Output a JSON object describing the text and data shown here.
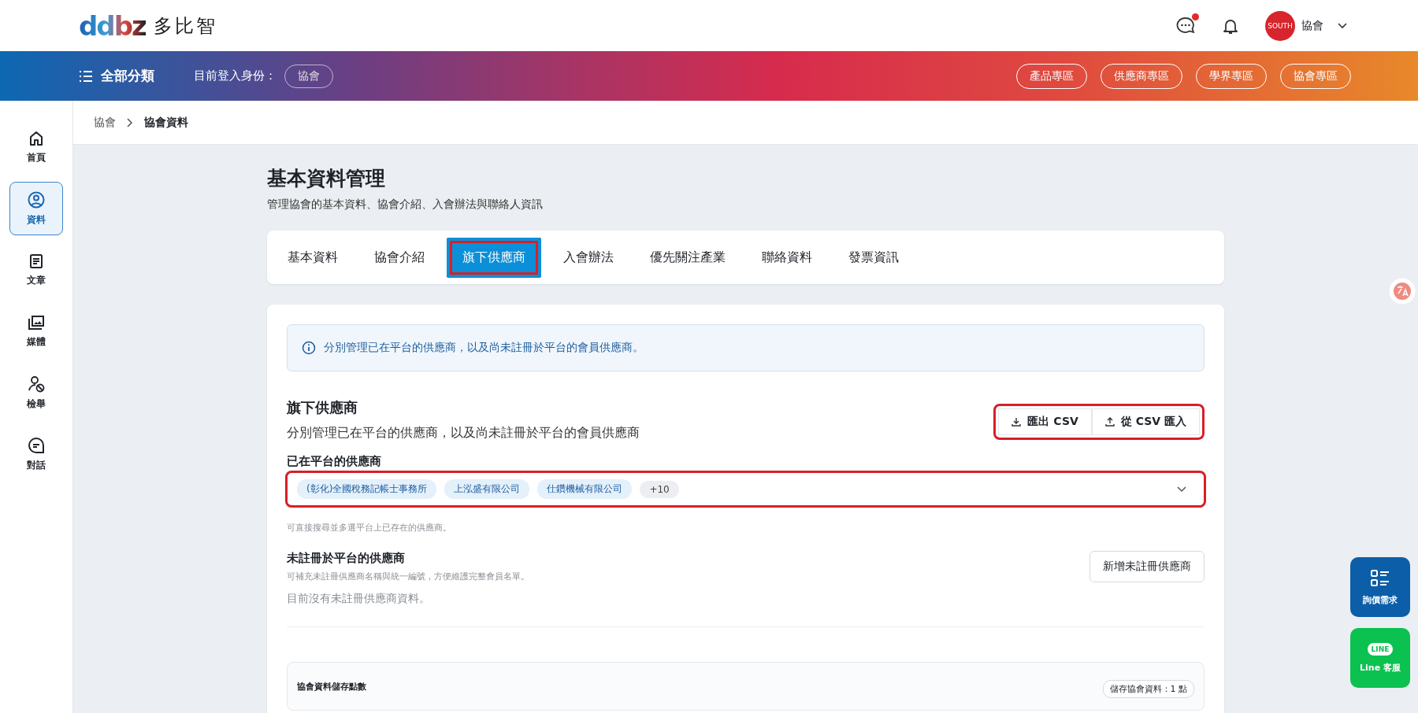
{
  "header": {
    "logo": "ddbz",
    "brand": "多比智",
    "chat_unread": true,
    "avatar_text": "SOUTH",
    "user": "協會"
  },
  "nav": {
    "menu": "全部分類",
    "identity_label": "目前登入身份：",
    "identity": "協會",
    "zones": [
      "產品專區",
      "供應商專區",
      "學界專區",
      "協會專區"
    ]
  },
  "sidebar": [
    {
      "label": "首頁",
      "kind": "home",
      "selected": false
    },
    {
      "label": "資料",
      "kind": "profile",
      "selected": true
    },
    {
      "label": "文章",
      "kind": "article",
      "selected": false
    },
    {
      "label": "媒體",
      "kind": "media",
      "selected": false
    },
    {
      "label": "檢舉",
      "kind": "report",
      "selected": false
    },
    {
      "label": "對話",
      "kind": "chat",
      "selected": false
    }
  ],
  "breadcrumb": [
    "協會",
    "協會資料"
  ],
  "page": {
    "title": "基本資料管理",
    "subtitle": "管理協會的基本資料、協會介紹、入會辦法與聯絡人資訊"
  },
  "tabs": [
    {
      "label": "基本資料",
      "selected": false,
      "highlighted": false
    },
    {
      "label": "協會介紹",
      "selected": false,
      "highlighted": false
    },
    {
      "label": "旗下供應商",
      "selected": true,
      "highlighted": true
    },
    {
      "label": "入會辦法",
      "selected": false,
      "highlighted": false
    },
    {
      "label": "優先關注產業",
      "selected": false,
      "highlighted": false
    },
    {
      "label": "聯絡資料",
      "selected": false,
      "highlighted": false
    },
    {
      "label": "發票資訊",
      "selected": false,
      "highlighted": false
    }
  ],
  "info": "分別管理已在平台的供應商，以及尚未註冊於平台的會員供應商。",
  "section": {
    "title": "旗下供應商",
    "desc": "分別管理已在平台的供應商，以及尚未註冊於平台的會員供應商",
    "highlighted": true,
    "export": "匯出 CSV",
    "import": "從 CSV 匯入"
  },
  "registered": {
    "label": "已在平台的供應商",
    "highlighted": true,
    "tags": [
      "(彰化)全國稅務記帳士事務所",
      "上泓盛有限公司",
      "仕鑽機械有限公司"
    ],
    "more": "+10",
    "hint": "可直接搜尋並多選平台上已存在的供應商。"
  },
  "unregistered": {
    "title": "未註冊於平台的供應商",
    "desc": "可補充未註冊供應商名稱與統一編號，方便維護完整會員名單。",
    "add": "新增未註冊供應商",
    "empty": "目前沒有未註冊供應商資料。"
  },
  "storage": {
    "title": "協會資料儲存點數",
    "badge": "儲存協會資料：1 點"
  },
  "float": [
    {
      "label": "詢價需求",
      "kind": "quote"
    },
    {
      "label": "Line 客服",
      "kind": "line",
      "badge": "LINE"
    }
  ]
}
